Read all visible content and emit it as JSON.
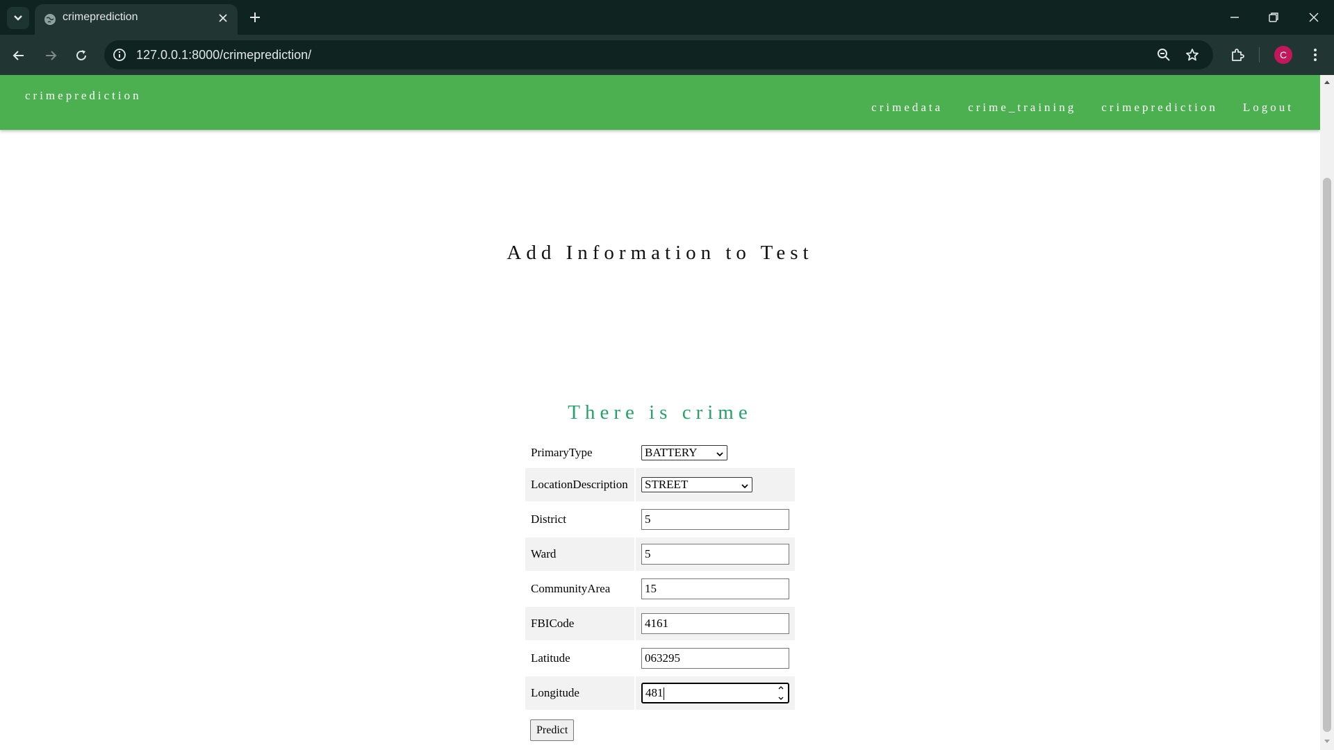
{
  "browser": {
    "tab_title": "crimeprediction",
    "url": "127.0.0.1:8000/crimeprediction/",
    "profile_initial": "C",
    "colors": {
      "frame": "#0f2421",
      "toolbar": "#213532",
      "profile": "#c2185b"
    }
  },
  "site": {
    "brand": "crimeprediction",
    "nav": [
      "crimedata",
      "crime_training",
      "crimeprediction",
      "Logout"
    ],
    "header_color": "#4caf50"
  },
  "page": {
    "title": "Add Information to Test",
    "result": "There is crime",
    "result_color": "#26a269"
  },
  "form": {
    "fields": [
      {
        "label": "PrimaryType",
        "type": "select",
        "value": "BATTERY"
      },
      {
        "label": "LocationDescription",
        "type": "select",
        "value": "STREET"
      },
      {
        "label": "District",
        "type": "text",
        "value": "5"
      },
      {
        "label": "Ward",
        "type": "text",
        "value": "5"
      },
      {
        "label": "CommunityArea",
        "type": "text",
        "value": "15"
      },
      {
        "label": "FBICode",
        "type": "text",
        "value": "4161"
      },
      {
        "label": "Latitude",
        "type": "text",
        "value": "063295"
      },
      {
        "label": "Longitude",
        "type": "number",
        "value": "481"
      }
    ],
    "submit_label": "Predict"
  },
  "icons": [
    "tab-list-icon",
    "globe-icon",
    "close-icon",
    "plus-icon",
    "minimize-icon",
    "restore-icon",
    "back-icon",
    "forward-icon",
    "reload-icon",
    "info-icon",
    "zoom-icon",
    "star-icon",
    "extensions-icon",
    "more-icon"
  ]
}
